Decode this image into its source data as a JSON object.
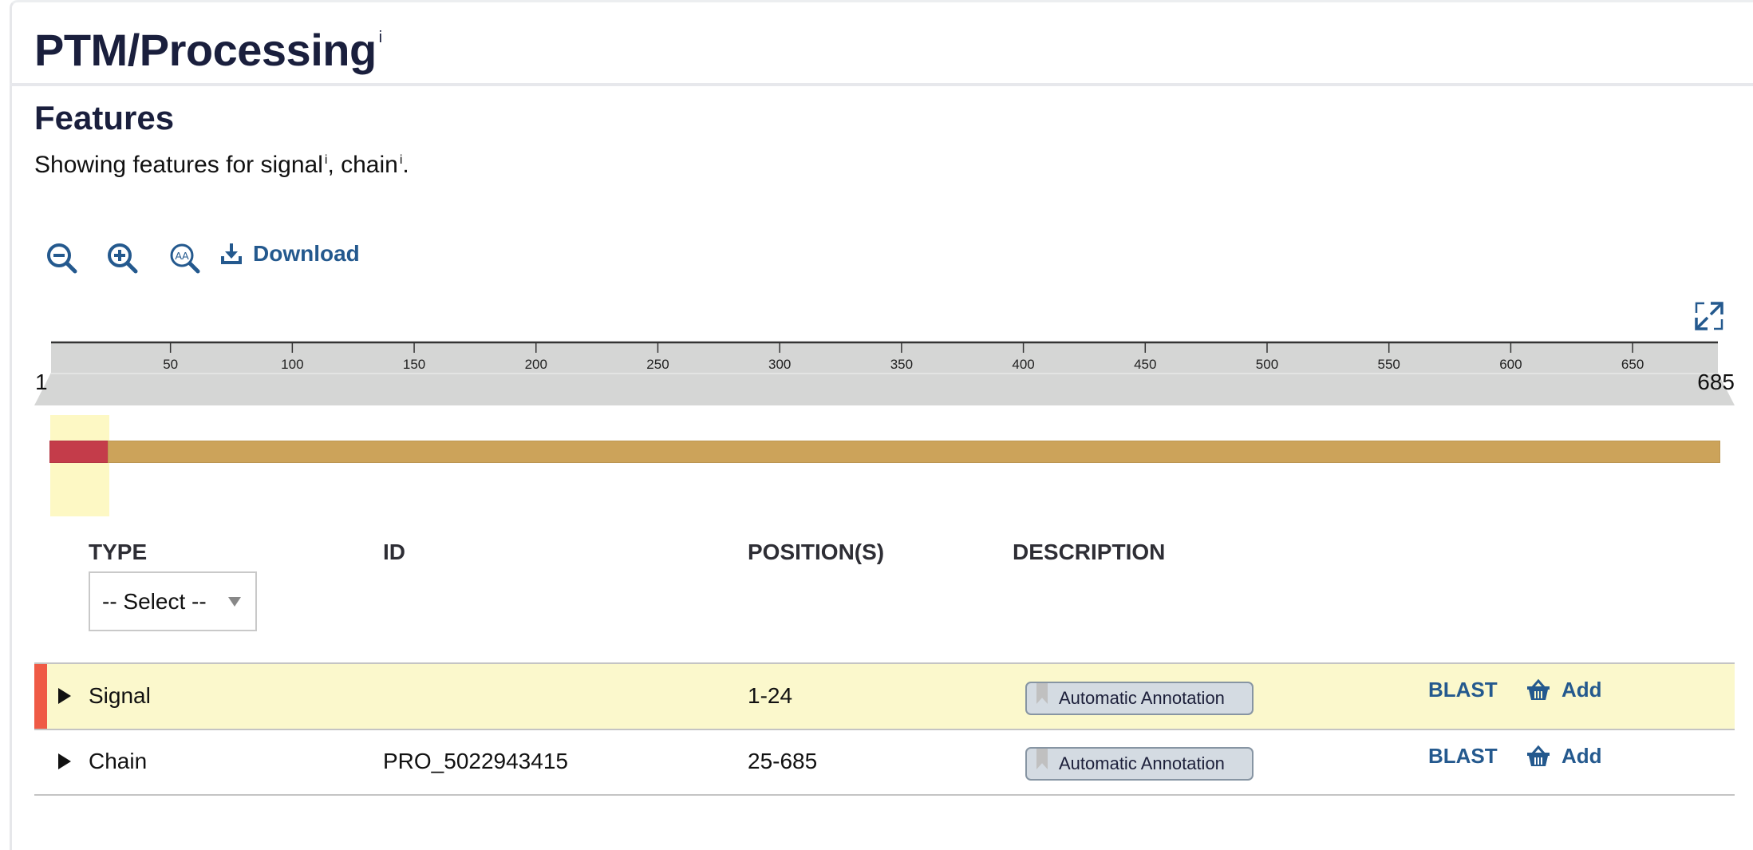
{
  "section": {
    "title": "PTM/Processing",
    "info": "i"
  },
  "features": {
    "title": "Features",
    "description_prefix": "Showing features for ",
    "desc_items": [
      {
        "label": "signal",
        "info": "i"
      },
      {
        "label": "chain",
        "info": "i"
      }
    ],
    "separator": ", ",
    "suffix": "."
  },
  "toolbar": {
    "zoom_out": "zoom-out-icon",
    "zoom_in": "zoom-in-icon",
    "zoom_to_sequence": "zoom-sequence-icon",
    "download_label": "Download",
    "expand": "fullscreen-icon"
  },
  "ruler": {
    "start": 1,
    "end": 685,
    "ticks": [
      50,
      100,
      150,
      200,
      250,
      300,
      350,
      400,
      450,
      500,
      550,
      600,
      650
    ],
    "start_label": "1",
    "end_label": "685"
  },
  "track": {
    "features": [
      {
        "type": "Signal",
        "start": 1,
        "end": 24,
        "color": "#c43c4a"
      },
      {
        "type": "Chain",
        "start": 25,
        "end": 685,
        "color": "#cca35a"
      }
    ],
    "highlight": {
      "start": 1,
      "end": 24,
      "color": "#fdf8c4"
    }
  },
  "table": {
    "headers": {
      "type": "TYPE",
      "id": "ID",
      "positions": "POSITION(S)",
      "description": "DESCRIPTION"
    },
    "type_filter": "-- Select --",
    "rows": [
      {
        "type": "Signal",
        "id": "",
        "positions": "1-24",
        "evidence": "Automatic Annotation",
        "blast": "BLAST",
        "add": "Add",
        "highlighted": true
      },
      {
        "type": "Chain",
        "id": "PRO_5022943415",
        "positions": "25-685",
        "evidence": "Automatic Annotation",
        "blast": "BLAST",
        "add": "Add",
        "highlighted": false
      }
    ]
  },
  "colors": {
    "link": "#24598e",
    "title": "#1a1f3d",
    "row_highlight": "#fbf8cc",
    "row_marker": "#ef5a45"
  }
}
